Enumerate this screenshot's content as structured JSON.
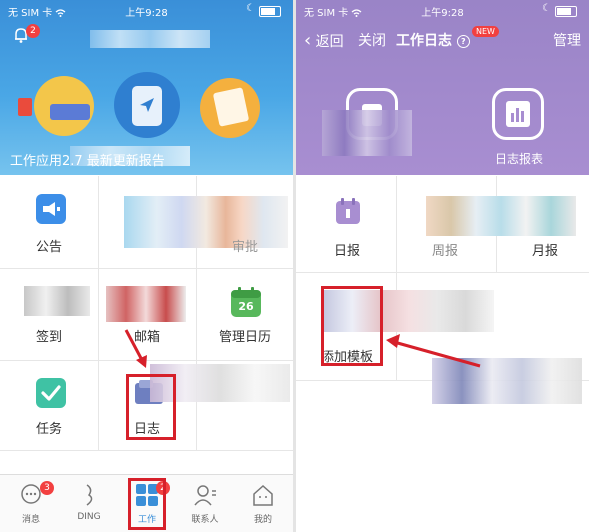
{
  "left": {
    "status": {
      "carrier": "无 SIM 卡 ",
      "time": "上午9:28"
    },
    "notifications": {
      "count": "2"
    },
    "banner": {
      "caption": "工作应用2.7 最新更新报告"
    },
    "grid": {
      "announcement": "公告",
      "approval": "审批",
      "checkin": "签到",
      "mail": "邮箱",
      "calendar_label": "管理日历",
      "calendar_day": "26",
      "tasks": "任务",
      "log": "日志"
    },
    "tabs": [
      {
        "label": "消息",
        "badge": "3"
      },
      {
        "label": "DING",
        "badge": ""
      },
      {
        "label": "工作",
        "badge": "2"
      },
      {
        "label": "联系人",
        "badge": ""
      },
      {
        "label": "我的",
        "badge": ""
      }
    ]
  },
  "right": {
    "status": {
      "carrier": "无 SIM 卡 ",
      "time": "上午9:28"
    },
    "nav": {
      "back": "返回",
      "close": "关闭",
      "title": "工作日志",
      "new_badge": "NEW",
      "manage": "管理"
    },
    "header": {
      "report_label": "日志报表"
    },
    "grid": {
      "daily": "日报",
      "weekly": "周报",
      "monthly": "月报",
      "add_template": "添加模板"
    }
  },
  "colors": {
    "accent_blue": "#3a8fd8",
    "accent_purple": "#a88ed1",
    "highlight_red": "#d6202a"
  }
}
